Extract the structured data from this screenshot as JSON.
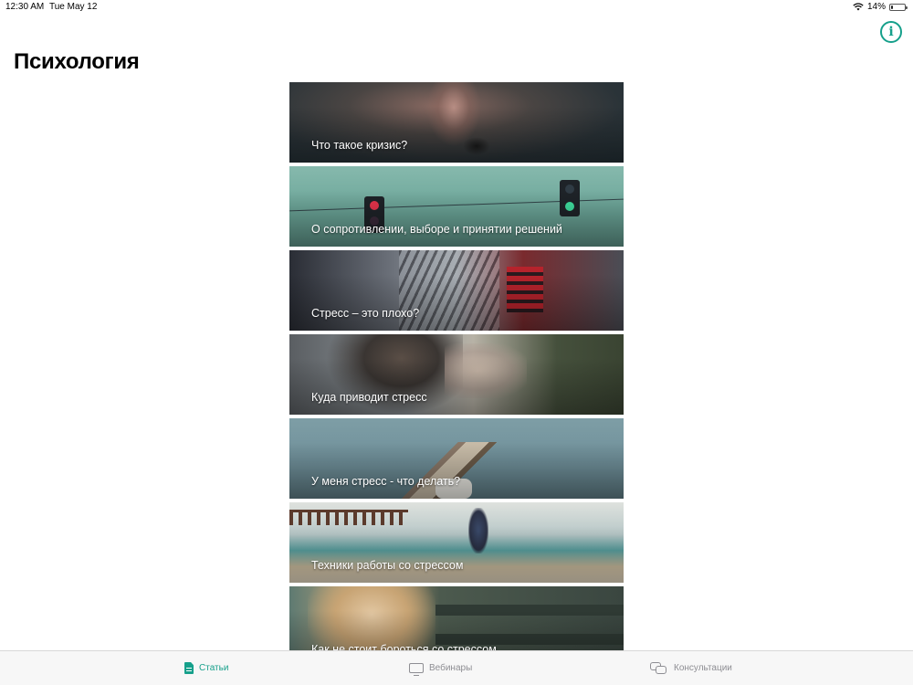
{
  "status_bar": {
    "time": "12:30 AM",
    "date": "Tue May 12",
    "battery": "14%",
    "battery_level": 0.14
  },
  "header": {
    "title": "Психология",
    "info_icon": "info-circle-icon",
    "accent_color": "#16a08b"
  },
  "articles": [
    {
      "title": "Что такое кризис?"
    },
    {
      "title": "О сопротивлении, выборе и принятии решений"
    },
    {
      "title": "Стресс – это плохо?"
    },
    {
      "title": "Куда приводит стресс"
    },
    {
      "title": "У меня стресс - что делать?"
    },
    {
      "title": "Техники работы со стрессом"
    },
    {
      "title": "Как не стоит бороться со стрессом"
    }
  ],
  "tab_bar": {
    "tabs": [
      {
        "label": "Статьи",
        "icon": "document-icon",
        "active": true
      },
      {
        "label": "Вебинары",
        "icon": "tv-icon",
        "active": false
      },
      {
        "label": "Консультации",
        "icon": "chat-bubbles-icon",
        "active": false
      }
    ]
  }
}
